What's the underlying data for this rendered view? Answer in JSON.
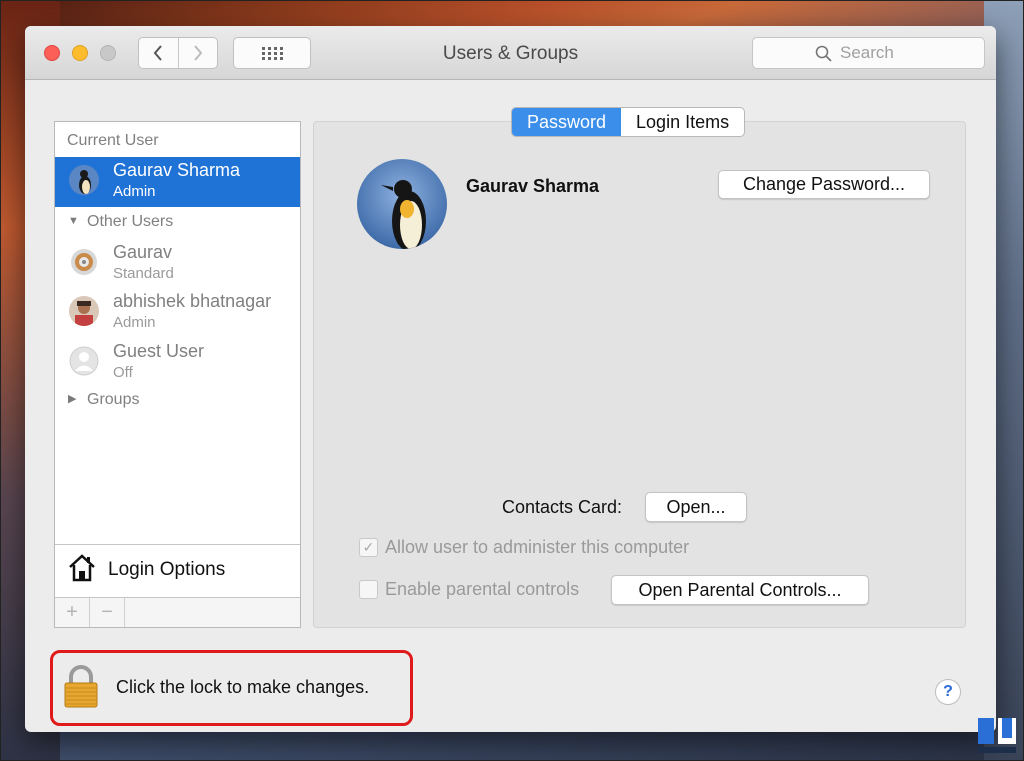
{
  "window": {
    "title": "Users & Groups"
  },
  "search": {
    "placeholder": "Search"
  },
  "sidebar": {
    "current_user_header": "Current User",
    "current_user": {
      "name": "Gaurav Sharma",
      "role": "Admin"
    },
    "other_users_header": "Other Users",
    "other_users": [
      {
        "name": "Gaurav",
        "role": "Standard"
      },
      {
        "name": "abhishek bhatnagar",
        "role": "Admin"
      },
      {
        "name": "Guest User",
        "role": "Off"
      }
    ],
    "groups_header": "Groups",
    "login_options": "Login Options",
    "add_symbol": "+",
    "remove_symbol": "−"
  },
  "tabs": [
    {
      "label": "Password",
      "active": true
    },
    {
      "label": "Login Items",
      "active": false
    }
  ],
  "detail": {
    "user_name": "Gaurav Sharma",
    "change_password": "Change Password...",
    "contacts_card_label": "Contacts Card:",
    "open_button": "Open...",
    "allow_admin_label": "Allow user to administer this computer",
    "allow_admin_checked": true,
    "parental_label": "Enable parental controls",
    "parental_checked": false,
    "open_parental": "Open Parental Controls..."
  },
  "footer": {
    "lock_text": "Click the lock to make changes.",
    "help": "?"
  },
  "colors": {
    "selection": "#1f72d6",
    "segment_active": "#3b8eea",
    "highlight_box": "#e01a1a"
  }
}
